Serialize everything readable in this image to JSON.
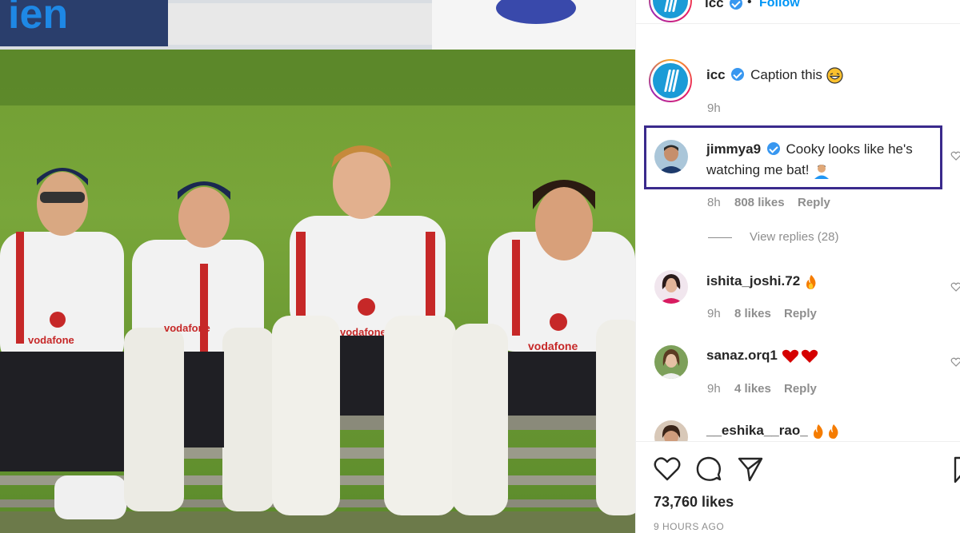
{
  "header": {
    "username": "icc",
    "follow_label": "Follow",
    "separator": "•"
  },
  "caption": {
    "username": "icc",
    "text": "Caption this",
    "emoji": "grinning-face-emoji",
    "time": "9h"
  },
  "comments": [
    {
      "username": "jimmya9",
      "verified": true,
      "text_line1": "Cooky looks like he's",
      "text_line2": "watching me bat!",
      "emoji": "person-emoji",
      "time": "8h",
      "likes": "808 likes",
      "reply": "Reply",
      "view_replies": "View replies (28)",
      "highlighted": true
    },
    {
      "username": "ishita_joshi.72",
      "text": "",
      "emoji": "fire-emoji",
      "time": "9h",
      "likes": "8 likes",
      "reply": "Reply"
    },
    {
      "username": "sanaz.orq1",
      "text": "",
      "emoji": "hearts-emoji",
      "time": "9h",
      "likes": "4 likes",
      "reply": "Reply"
    },
    {
      "username": "__eshika__rao_",
      "text": "",
      "emoji": "fire-emoji"
    }
  ],
  "footer": {
    "likes": "73,760 likes",
    "time_ago": "9 HOURS AGO"
  },
  "colors": {
    "verified": "#3897f0",
    "follow": "#0095f6",
    "highlight_border": "#3a2a8c",
    "icc_blue": "#1b9bd7"
  }
}
